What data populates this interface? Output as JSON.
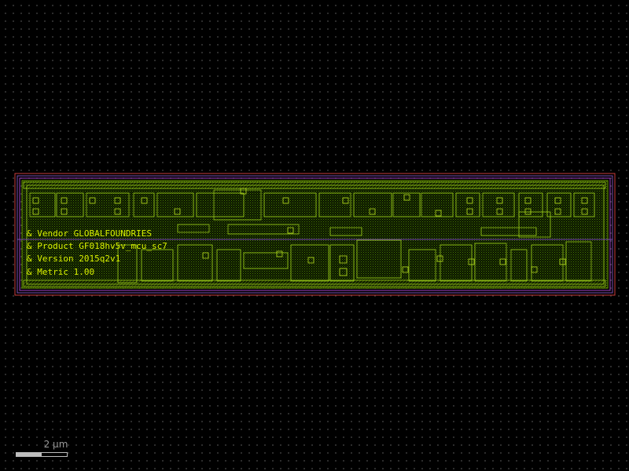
{
  "view": {
    "background": "#000000",
    "grid_dot_color": "#3a3a3a"
  },
  "colors": {
    "metal1": "#6ea000",
    "metal_bright": "#9ccc1a",
    "poly": "#c83c3c",
    "nwell": "#7a4fb0",
    "boundary": "#a040c0",
    "label": "#d8f000",
    "fill_hatch": "#3f6a00"
  },
  "cell": {
    "labels": [
      "& Vendor GLOBALFOUNDRIES",
      "& Product GF018hv5v_mcu_sc7",
      "& Version 2015q2v1",
      "& Metric 1.00"
    ]
  },
  "scale_bar": {
    "label": "2 µm",
    "fill_fraction": 0.5
  }
}
